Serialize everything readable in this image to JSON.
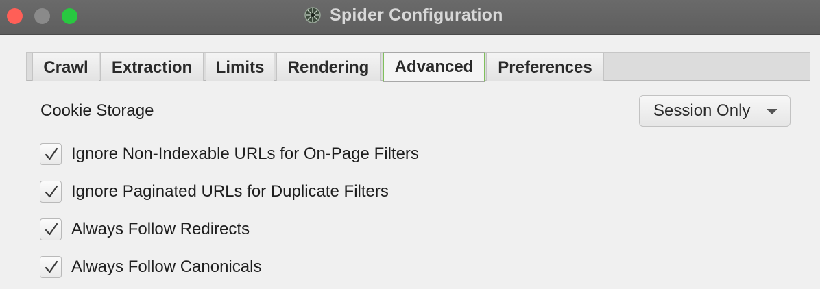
{
  "window": {
    "title": "Spider Configuration",
    "app_icon": "spider-app-icon"
  },
  "tabs": [
    {
      "label": "Crawl",
      "active": false
    },
    {
      "label": "Extraction",
      "active": false
    },
    {
      "label": "Limits",
      "active": false
    },
    {
      "label": "Rendering",
      "active": false
    },
    {
      "label": "Advanced",
      "active": true
    },
    {
      "label": "Preferences",
      "active": false
    }
  ],
  "cookie_storage": {
    "label": "Cookie Storage",
    "selected": "Session Only"
  },
  "checkboxes": [
    {
      "label": "Ignore Non-Indexable URLs for On-Page Filters",
      "checked": true
    },
    {
      "label": "Ignore Paginated URLs for Duplicate Filters",
      "checked": true
    },
    {
      "label": "Always Follow Redirects",
      "checked": true
    },
    {
      "label": "Always Follow Canonicals",
      "checked": true
    }
  ],
  "colors": {
    "active_tab_accent": "#7fbf5b",
    "close": "#ff5f57",
    "maximize": "#28c840"
  }
}
